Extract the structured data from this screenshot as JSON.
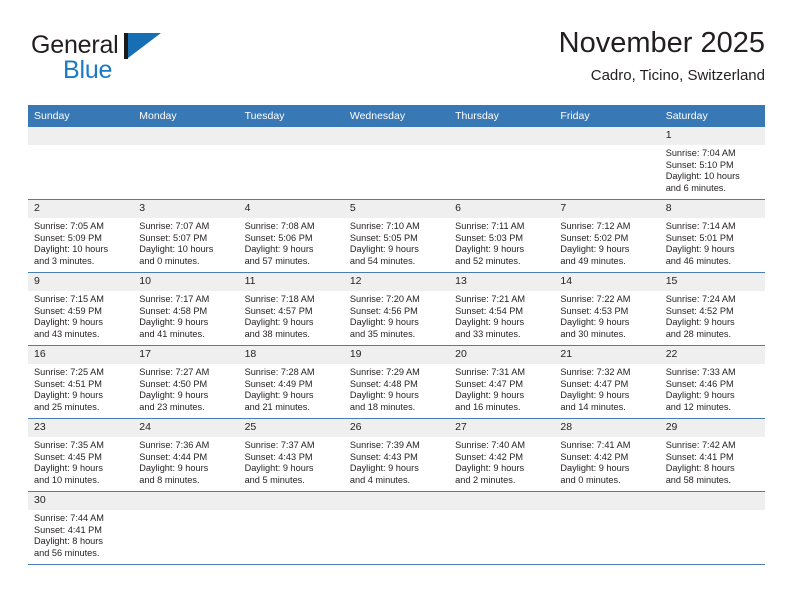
{
  "brand": {
    "name_part1": "General",
    "name_part2": "Blue",
    "flag_icon": "blue-flag-icon",
    "colors": {
      "text": "#231f20",
      "blue": "#1b7ac7",
      "flag": "#166fb5"
    }
  },
  "header": {
    "title": "November 2025",
    "subtitle": "Cadro, Ticino, Switzerland"
  },
  "theme": {
    "header_bg": "#3878b4",
    "row_rule": "#4a7cb5",
    "daynum_bg": "#efefef",
    "page_bg": "#ffffff"
  },
  "calendar": {
    "weekday_headers": [
      "Sunday",
      "Monday",
      "Tuesday",
      "Wednesday",
      "Thursday",
      "Friday",
      "Saturday"
    ],
    "weeks": [
      [
        {
          "day": "",
          "lines": []
        },
        {
          "day": "",
          "lines": []
        },
        {
          "day": "",
          "lines": []
        },
        {
          "day": "",
          "lines": []
        },
        {
          "day": "",
          "lines": []
        },
        {
          "day": "",
          "lines": []
        },
        {
          "day": "1",
          "lines": [
            "Sunrise: 7:04 AM",
            "Sunset: 5:10 PM",
            "Daylight: 10 hours",
            "and 6 minutes."
          ]
        }
      ],
      [
        {
          "day": "2",
          "lines": [
            "Sunrise: 7:05 AM",
            "Sunset: 5:09 PM",
            "Daylight: 10 hours",
            "and 3 minutes."
          ]
        },
        {
          "day": "3",
          "lines": [
            "Sunrise: 7:07 AM",
            "Sunset: 5:07 PM",
            "Daylight: 10 hours",
            "and 0 minutes."
          ]
        },
        {
          "day": "4",
          "lines": [
            "Sunrise: 7:08 AM",
            "Sunset: 5:06 PM",
            "Daylight: 9 hours",
            "and 57 minutes."
          ]
        },
        {
          "day": "5",
          "lines": [
            "Sunrise: 7:10 AM",
            "Sunset: 5:05 PM",
            "Daylight: 9 hours",
            "and 54 minutes."
          ]
        },
        {
          "day": "6",
          "lines": [
            "Sunrise: 7:11 AM",
            "Sunset: 5:03 PM",
            "Daylight: 9 hours",
            "and 52 minutes."
          ]
        },
        {
          "day": "7",
          "lines": [
            "Sunrise: 7:12 AM",
            "Sunset: 5:02 PM",
            "Daylight: 9 hours",
            "and 49 minutes."
          ]
        },
        {
          "day": "8",
          "lines": [
            "Sunrise: 7:14 AM",
            "Sunset: 5:01 PM",
            "Daylight: 9 hours",
            "and 46 minutes."
          ]
        }
      ],
      [
        {
          "day": "9",
          "lines": [
            "Sunrise: 7:15 AM",
            "Sunset: 4:59 PM",
            "Daylight: 9 hours",
            "and 43 minutes."
          ]
        },
        {
          "day": "10",
          "lines": [
            "Sunrise: 7:17 AM",
            "Sunset: 4:58 PM",
            "Daylight: 9 hours",
            "and 41 minutes."
          ]
        },
        {
          "day": "11",
          "lines": [
            "Sunrise: 7:18 AM",
            "Sunset: 4:57 PM",
            "Daylight: 9 hours",
            "and 38 minutes."
          ]
        },
        {
          "day": "12",
          "lines": [
            "Sunrise: 7:20 AM",
            "Sunset: 4:56 PM",
            "Daylight: 9 hours",
            "and 35 minutes."
          ]
        },
        {
          "day": "13",
          "lines": [
            "Sunrise: 7:21 AM",
            "Sunset: 4:54 PM",
            "Daylight: 9 hours",
            "and 33 minutes."
          ]
        },
        {
          "day": "14",
          "lines": [
            "Sunrise: 7:22 AM",
            "Sunset: 4:53 PM",
            "Daylight: 9 hours",
            "and 30 minutes."
          ]
        },
        {
          "day": "15",
          "lines": [
            "Sunrise: 7:24 AM",
            "Sunset: 4:52 PM",
            "Daylight: 9 hours",
            "and 28 minutes."
          ]
        }
      ],
      [
        {
          "day": "16",
          "lines": [
            "Sunrise: 7:25 AM",
            "Sunset: 4:51 PM",
            "Daylight: 9 hours",
            "and 25 minutes."
          ]
        },
        {
          "day": "17",
          "lines": [
            "Sunrise: 7:27 AM",
            "Sunset: 4:50 PM",
            "Daylight: 9 hours",
            "and 23 minutes."
          ]
        },
        {
          "day": "18",
          "lines": [
            "Sunrise: 7:28 AM",
            "Sunset: 4:49 PM",
            "Daylight: 9 hours",
            "and 21 minutes."
          ]
        },
        {
          "day": "19",
          "lines": [
            "Sunrise: 7:29 AM",
            "Sunset: 4:48 PM",
            "Daylight: 9 hours",
            "and 18 minutes."
          ]
        },
        {
          "day": "20",
          "lines": [
            "Sunrise: 7:31 AM",
            "Sunset: 4:47 PM",
            "Daylight: 9 hours",
            "and 16 minutes."
          ]
        },
        {
          "day": "21",
          "lines": [
            "Sunrise: 7:32 AM",
            "Sunset: 4:47 PM",
            "Daylight: 9 hours",
            "and 14 minutes."
          ]
        },
        {
          "day": "22",
          "lines": [
            "Sunrise: 7:33 AM",
            "Sunset: 4:46 PM",
            "Daylight: 9 hours",
            "and 12 minutes."
          ]
        }
      ],
      [
        {
          "day": "23",
          "lines": [
            "Sunrise: 7:35 AM",
            "Sunset: 4:45 PM",
            "Daylight: 9 hours",
            "and 10 minutes."
          ]
        },
        {
          "day": "24",
          "lines": [
            "Sunrise: 7:36 AM",
            "Sunset: 4:44 PM",
            "Daylight: 9 hours",
            "and 8 minutes."
          ]
        },
        {
          "day": "25",
          "lines": [
            "Sunrise: 7:37 AM",
            "Sunset: 4:43 PM",
            "Daylight: 9 hours",
            "and 5 minutes."
          ]
        },
        {
          "day": "26",
          "lines": [
            "Sunrise: 7:39 AM",
            "Sunset: 4:43 PM",
            "Daylight: 9 hours",
            "and 4 minutes."
          ]
        },
        {
          "day": "27",
          "lines": [
            "Sunrise: 7:40 AM",
            "Sunset: 4:42 PM",
            "Daylight: 9 hours",
            "and 2 minutes."
          ]
        },
        {
          "day": "28",
          "lines": [
            "Sunrise: 7:41 AM",
            "Sunset: 4:42 PM",
            "Daylight: 9 hours",
            "and 0 minutes."
          ]
        },
        {
          "day": "29",
          "lines": [
            "Sunrise: 7:42 AM",
            "Sunset: 4:41 PM",
            "Daylight: 8 hours",
            "and 58 minutes."
          ]
        }
      ],
      [
        {
          "day": "30",
          "lines": [
            "Sunrise: 7:44 AM",
            "Sunset: 4:41 PM",
            "Daylight: 8 hours",
            "and 56 minutes."
          ]
        },
        {
          "day": "",
          "lines": []
        },
        {
          "day": "",
          "lines": []
        },
        {
          "day": "",
          "lines": []
        },
        {
          "day": "",
          "lines": []
        },
        {
          "day": "",
          "lines": []
        },
        {
          "day": "",
          "lines": []
        }
      ]
    ]
  }
}
